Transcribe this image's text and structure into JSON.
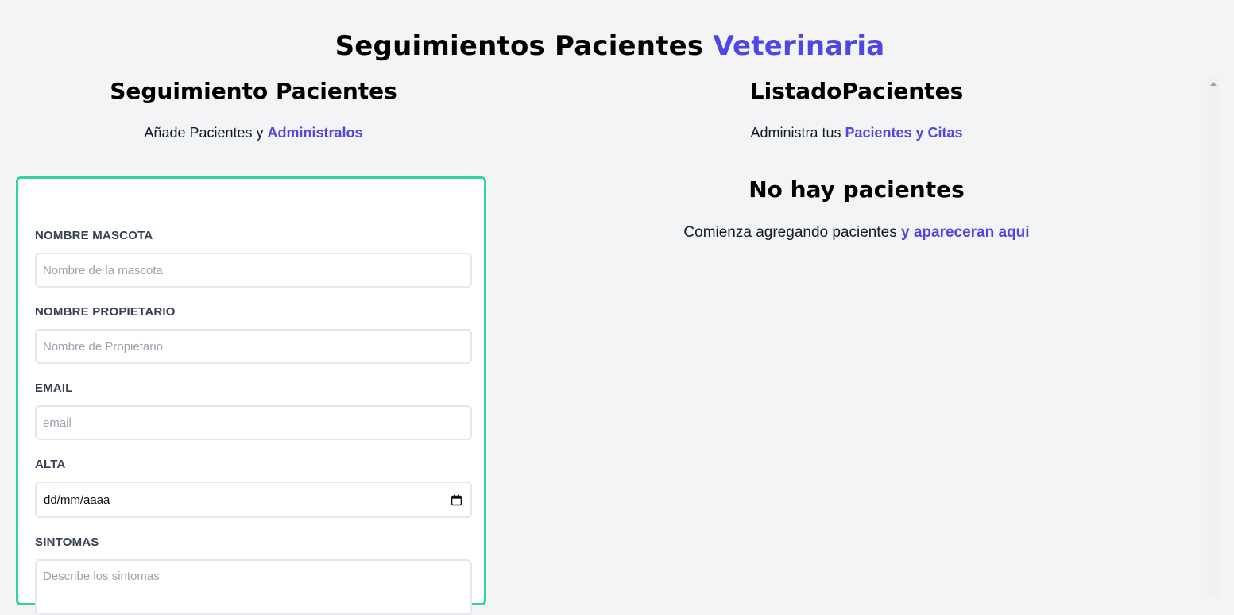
{
  "header": {
    "title_main": "Seguimientos Pacientes ",
    "title_accent": "Veterinaria"
  },
  "form_section": {
    "heading": "Seguimiento Pacientes",
    "subtitle_plain": "Añade Pacientes y ",
    "subtitle_accent": "Administralos",
    "fields": {
      "pet_name": {
        "label": "Nombre Mascota",
        "placeholder": "Nombre de la mascota",
        "value": ""
      },
      "owner_name": {
        "label": "Nombre Propietario",
        "placeholder": "Nombre de Propietario",
        "value": ""
      },
      "email": {
        "label": "Email",
        "placeholder": "email",
        "value": ""
      },
      "discharge": {
        "label": "Alta",
        "value": "dd/mm/aaaa",
        "icon": "calendar-icon"
      },
      "symptoms": {
        "label": "Sintomas",
        "placeholder": "Describe los sintomas",
        "value": ""
      }
    }
  },
  "list_section": {
    "heading": "ListadoPacientes",
    "subtitle_plain": "Administra tus ",
    "subtitle_accent": "Pacientes y Citas",
    "empty_heading": "No hay pacientes",
    "empty_plain": "Comienza agregando pacientes ",
    "empty_accent": "y apareceran aqui"
  },
  "colors": {
    "accent": "#4f46e5",
    "form_border": "#34d399",
    "background": "#f3f4f6"
  }
}
